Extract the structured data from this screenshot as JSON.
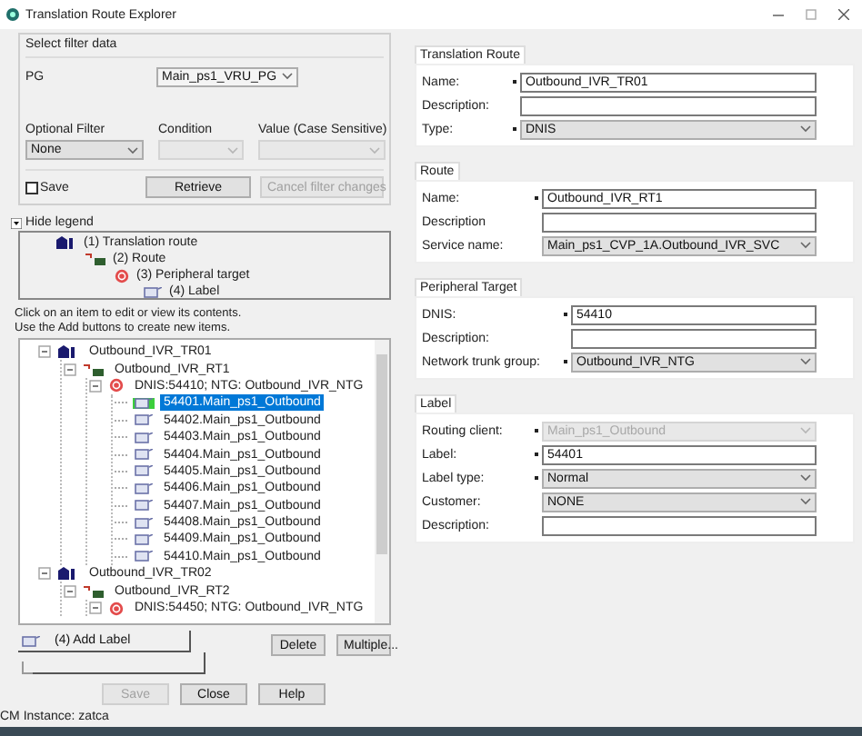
{
  "window": {
    "title": "Translation Route Explorer"
  },
  "filter": {
    "title": "Select filter data",
    "pg": {
      "label": "PG",
      "value": "Main_ps1_VRU_PG"
    },
    "optional_filter": {
      "label": "Optional Filter",
      "value": "None",
      "disabled": false
    },
    "condition": {
      "label": "Condition",
      "disabled": true
    },
    "value_field": {
      "label": "Value (Case Sensitive)",
      "disabled": true
    },
    "save": {
      "label": "Save",
      "checked": false
    },
    "buttons": [
      {
        "label": "Retrieve",
        "disabled": false
      },
      {
        "label": "Cancel filter changes",
        "disabled": true
      }
    ]
  },
  "legend": {
    "toggle": "Hide legend",
    "items": [
      {
        "kind": "translation_route",
        "label": "(1) Translation route",
        "children": [
          {
            "kind": "route",
            "label": "(2) Route",
            "children": [
              {
                "kind": "peripheral_target",
                "label": "(3) Peripheral target",
                "children": [
                  {
                    "kind": "label",
                    "label": "(4) Label"
                  }
                ]
              }
            ]
          }
        ]
      }
    ]
  },
  "instructions": [
    "Click on an item to edit or view its contents.",
    "Use the Add buttons to create new items."
  ],
  "tree": [
    {
      "kind": "translation_route",
      "label": "Outbound_IVR_TR01",
      "expanded": true,
      "selected": false,
      "children": [
        {
          "kind": "route",
          "label": "Outbound_IVR_RT1",
          "expanded": true,
          "selected": false,
          "children": [
            {
              "kind": "peripheral_target",
              "label": "DNIS:54410; NTG: Outbound_IVR_NTG",
              "expanded": true,
              "selected": false,
              "children": [
                {
                  "kind": "label",
                  "label": "54401.Main_ps1_Outbound",
                  "selected": true
                },
                {
                  "kind": "label",
                  "label": "54402.Main_ps1_Outbound",
                  "selected": false
                },
                {
                  "kind": "label",
                  "label": "54403.Main_ps1_Outbound",
                  "selected": false
                },
                {
                  "kind": "label",
                  "label": "54404.Main_ps1_Outbound",
                  "selected": false
                },
                {
                  "kind": "label",
                  "label": "54405.Main_ps1_Outbound",
                  "selected": false
                },
                {
                  "kind": "label",
                  "label": "54406.Main_ps1_Outbound",
                  "selected": false
                },
                {
                  "kind": "label",
                  "label": "54407.Main_ps1_Outbound",
                  "selected": false
                },
                {
                  "kind": "label",
                  "label": "54408.Main_ps1_Outbound",
                  "selected": false
                },
                {
                  "kind": "label",
                  "label": "54409.Main_ps1_Outbound",
                  "selected": false
                },
                {
                  "kind": "label",
                  "label": "54410.Main_ps1_Outbound",
                  "selected": false
                }
              ]
            }
          ]
        }
      ]
    },
    {
      "kind": "translation_route",
      "label": "Outbound_IVR_TR02",
      "expanded": true,
      "selected": false,
      "children": [
        {
          "kind": "route",
          "label": "Outbound_IVR_RT2",
          "expanded": true,
          "selected": false,
          "children": [
            {
              "kind": "peripheral_target",
              "label": "DNIS:54450; NTG: Outbound_IVR_NTG",
              "expanded": true,
              "selected": false
            }
          ]
        }
      ]
    }
  ],
  "add_button": {
    "label": "(4) Add Label"
  },
  "tree_buttons": [
    "Delete",
    "Multiple..."
  ],
  "footer_buttons": [
    {
      "label": "Save",
      "disabled": true
    },
    {
      "label": "Close",
      "disabled": false
    },
    {
      "label": "Help",
      "disabled": false
    }
  ],
  "status_bar": "CM Instance: zatca",
  "sections": [
    {
      "title": "Translation Route",
      "fields": [
        {
          "label": "Name:",
          "kind": "text",
          "required": true,
          "value": "Outbound_IVR_TR01",
          "disabled": false
        },
        {
          "label": "Description:",
          "kind": "text",
          "required": false,
          "disabled": false
        },
        {
          "label": "Type:",
          "kind": "select",
          "required": true,
          "value": "DNIS",
          "disabled": false
        }
      ]
    },
    {
      "title": "Route",
      "fields": [
        {
          "label": "Name:",
          "kind": "text",
          "required": true,
          "value": "Outbound_IVR_RT1",
          "disabled": false
        },
        {
          "label": "Description",
          "kind": "text",
          "required": false,
          "disabled": false
        },
        {
          "label": "Service name:",
          "kind": "select",
          "required": false,
          "value": "Main_ps1_CVP_1A.Outbound_IVR_SVC",
          "disabled": false
        }
      ]
    },
    {
      "title": "Peripheral Target",
      "fields": [
        {
          "label": "DNIS:",
          "kind": "text",
          "required": true,
          "value": "54410",
          "disabled": false
        },
        {
          "label": "Description:",
          "kind": "text",
          "required": false,
          "disabled": false
        },
        {
          "label": "Network trunk group:",
          "kind": "select",
          "required": true,
          "value": "Outbound_IVR_NTG",
          "disabled": false
        }
      ]
    },
    {
      "title": "Label",
      "fields": [
        {
          "label": "Routing client:",
          "kind": "select",
          "required": true,
          "value": "Main_ps1_Outbound",
          "disabled": true
        },
        {
          "label": "Label:",
          "kind": "text",
          "required": true,
          "value": "54401",
          "disabled": false
        },
        {
          "label": "Label type:",
          "kind": "select",
          "required": true,
          "value": "Normal",
          "disabled": false
        },
        {
          "label": "Customer:",
          "kind": "select",
          "required": false,
          "value": "NONE",
          "disabled": false
        },
        {
          "label": "Description:",
          "kind": "text",
          "required": false,
          "disabled": false
        }
      ]
    }
  ]
}
